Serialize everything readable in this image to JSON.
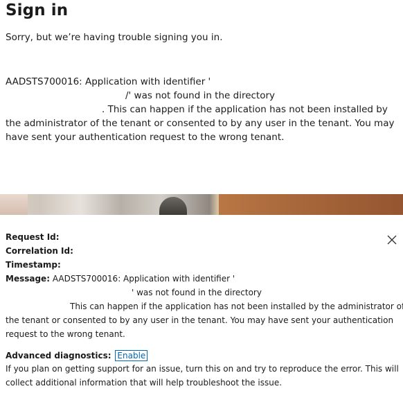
{
  "signin": {
    "title": "Sign in",
    "subtitle": "Sorry, but we’re having trouble signing you in.",
    "error_lines": [
      "AADSTS700016: Application with identifier '",
      "/' was not found in the directory",
      ". This can happen if the application has not been installed by",
      "the administrator of the tenant or consented to by any user in the tenant. You may",
      "have sent your authentication request to the wrong tenant."
    ]
  },
  "details": {
    "request_id_label": "Request Id:",
    "correlation_id_label": "Correlation Id:",
    "timestamp_label": "Timestamp:",
    "message_label": "Message:",
    "message_lines": [
      "AADSTS700016: Application with identifier '",
      "' was not found in the directory",
      "This can happen if the application has not been installed by the administrator of",
      "the tenant or consented to by any user in the tenant. You may have sent your authentication",
      "request to the wrong tenant."
    ],
    "advanced_label": "Advanced diagnostics:",
    "enable_label": "Enable",
    "hint_lines": [
      "If you plan on getting support for an issue, turn this on and try to reproduce the error. This will",
      "collect additional information that will help troubleshoot the issue."
    ],
    "close_icon": "close-icon"
  },
  "colors": {
    "link": "#0067b8",
    "text": "#1b1b1b"
  }
}
